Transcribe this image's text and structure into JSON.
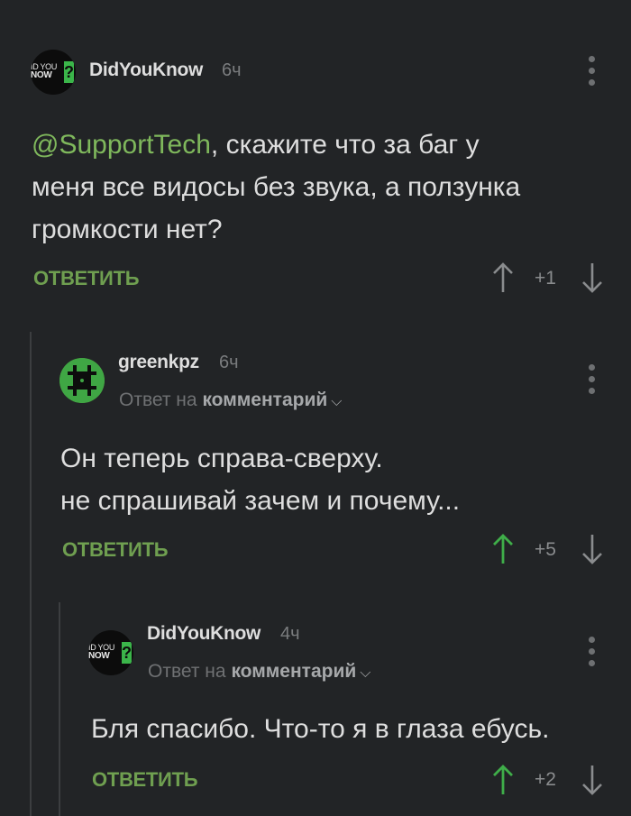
{
  "comments": [
    {
      "username": "DidYouKnow",
      "time": "6ч",
      "avatar_line1": "ID YOU",
      "avatar_line2": "NOW",
      "avatar_q": "?",
      "mention": "@SupportTech",
      "text_line1": ", скажите что за баг у",
      "text_line2": "меня все видосы без звука, а ползунка",
      "text_line3": "громкости нет?",
      "reply_label": "ОТВЕТИТЬ",
      "rating": "+1",
      "upvote_active": false
    },
    {
      "username": "greenkpz",
      "time": "6ч",
      "reply_prefix": "Ответ на",
      "reply_target": "комментарий",
      "text_line1": "Он теперь справа-сверху.",
      "text_line2": "не спрашивай зачем и почему...",
      "reply_label": "ОТВЕТИТЬ",
      "rating": "+5",
      "upvote_active": true
    },
    {
      "username": "DidYouKnow",
      "time": "4ч",
      "avatar_line1": "ID YOU",
      "avatar_line2": "NOW",
      "avatar_q": "?",
      "reply_prefix": "Ответ на",
      "reply_target": "комментарий",
      "text_line1": "Бля спасибо. Что-то я в глаза ебусь.",
      "reply_label": "ОТВЕТИТЬ",
      "rating": "+2",
      "upvote_active": true
    }
  ],
  "colors": {
    "background": "#222426",
    "accent_green": "#6f9f50",
    "upvote_active": "#3fae49",
    "arrow_inactive": "#8a8c8e"
  }
}
